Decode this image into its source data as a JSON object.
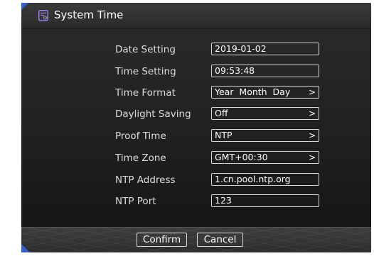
{
  "window": {
    "title": "System Time",
    "icon": "document-settings-icon",
    "accent_color": "#3a5dc8"
  },
  "settings": [
    {
      "label": "Date Setting",
      "value": "2019-01-02",
      "has_arrow": false
    },
    {
      "label": "Time Setting",
      "value": "09:53:48",
      "has_arrow": false
    },
    {
      "label": "Time Format",
      "value": "Year  Month  Day",
      "has_arrow": true
    },
    {
      "label": "Daylight Saving",
      "value": "Off",
      "has_arrow": true
    },
    {
      "label": "Proof Time",
      "value": "NTP",
      "has_arrow": true
    },
    {
      "label": "Time Zone",
      "value": "GMT+00:30",
      "has_arrow": true
    },
    {
      "label": "NTP Address",
      "value": "1.cn.pool.ntp.org",
      "has_arrow": false
    },
    {
      "label": "NTP Port",
      "value": "123",
      "has_arrow": false
    }
  ],
  "arrow_glyph": ">",
  "buttons": {
    "confirm": "Confirm",
    "cancel": "Cancel"
  }
}
